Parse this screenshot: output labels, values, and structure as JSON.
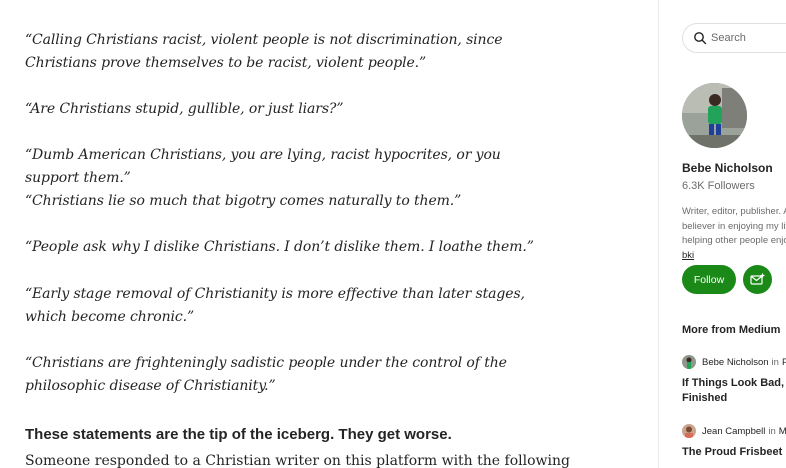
{
  "article": {
    "quotes": [
      "“Calling Christians racist, violent people is not discrimination, since Christians prove themselves to be racist, violent people.”",
      "“Are Christians stupid, gullible, or just liars?”",
      "“Dumb American Christians, you are lying, racist hypocrites, or you support them.”",
      "“Christians lie so much that bigotry comes naturally to them.”",
      "“People ask why I dislike Christians. I don’t dislike them. I loathe them.”",
      "“Early stage removal of Christianity is more effective than later stages, which become chronic.”",
      "“Christians are frighteningly sadistic people under the control of the philosophic disease of Christianity.”"
    ],
    "bold_statement": "These statements are the tip of the iceberg. They get worse.",
    "body_partial": "Someone responded to a Christian writer on this platform with the following"
  },
  "sidebar": {
    "search_placeholder": "Search",
    "author": {
      "name": "Bebe Nicholson",
      "followers": "6.3K Followers",
      "bio": "Writer, editor, publisher. A believer in enjoying my life and helping other people enjoy theirs.",
      "bio_link": "bki"
    },
    "follow_label": "Follow",
    "more_from": "More from Medium",
    "recommendations": [
      {
        "author": "Bebe Nicholson",
        "in": "in",
        "pub": "P",
        "title": "If Things Look Bad, Finished"
      },
      {
        "author": "Jean Campbell",
        "in": "in",
        "pub": "M",
        "title": "The Proud Frisbeet"
      }
    ]
  },
  "colors": {
    "accent_green": "#1a8917",
    "text_primary": "#242424",
    "text_secondary": "#6b6b6b",
    "divider": "#ececec"
  },
  "icons": [
    "search-icon",
    "subscribe-mail-icon"
  ]
}
